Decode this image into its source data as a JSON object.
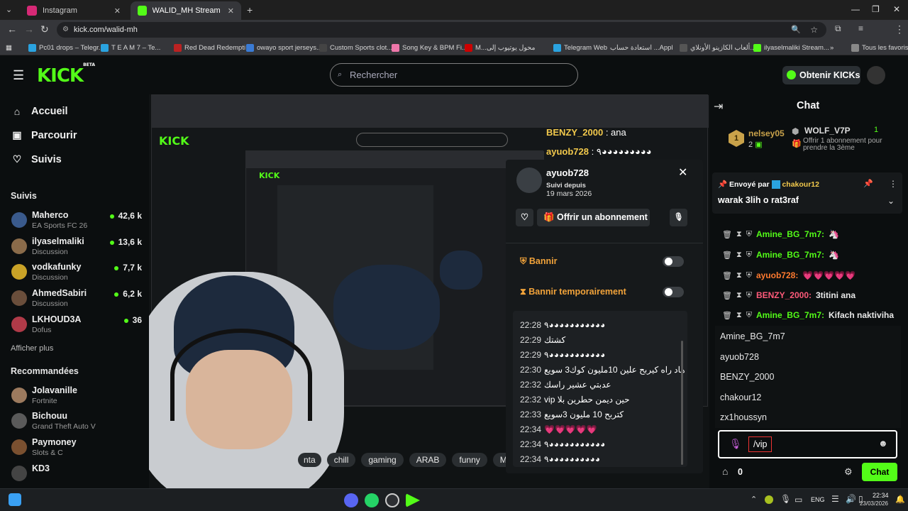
{
  "browser": {
    "tabs": [
      {
        "title": "Instagram",
        "color": "#d62976"
      },
      {
        "title": "WALID_MH Stream - Watch Live",
        "color": "#53fc18"
      }
    ],
    "url": "kick.com/walid-mh",
    "bookmarks": [
      "Pc01 drops – Telegr...",
      "T E A M 7 – Te...",
      "Red Dead Redempti...",
      "owayo sport jerseys...",
      "Custom Sports clot...",
      "Song Key & BPM Fi...",
      "M...محول يوتيوب إلى",
      "Telegram Web",
      "استعادة حساب ...Appl",
      "ألعاب الكازينو الأونلاي...",
      "ilyaselmaliki Stream...",
      "Tous les favoris"
    ]
  },
  "kick": {
    "logo": "KICK",
    "logo_sup": "BETA",
    "search_placeholder": "Rechercher",
    "get_kicks": "Obtenir KICKs"
  },
  "sidebar": {
    "nav": [
      {
        "label": "Accueil",
        "icon": "home-icon"
      },
      {
        "label": "Parcourir",
        "icon": "browse-icon"
      },
      {
        "label": "Suivis",
        "icon": "heart-icon"
      }
    ],
    "followed_title": "Suivis",
    "followed": [
      {
        "name": "Maherco",
        "category": "EA Sports FC 26",
        "viewers": "42,6 k",
        "color": "#3a5a8c"
      },
      {
        "name": "ilyaselmaliki",
        "category": "Discussion",
        "viewers": "13,6 k",
        "color": "#8a6b4a"
      },
      {
        "name": "vodkafunky",
        "category": "Discussion",
        "viewers": "7,7 k",
        "color": "#c9a227"
      },
      {
        "name": "AhmedSabiri",
        "category": "Discussion",
        "viewers": "6,2 k",
        "color": "#6a4e3b"
      },
      {
        "name": "LKHOUD3A",
        "category": "Dofus",
        "viewers": "36",
        "color": "#b03a48"
      }
    ],
    "show_more": "Afficher plus",
    "recommended_title": "Recommandées",
    "recommended": [
      {
        "name": "Jolavanille",
        "category": "Fortnite",
        "color": "#9c7a5e"
      },
      {
        "name": "Bichouu",
        "category": "Grand Theft Auto V",
        "color": "#5a5a5a"
      },
      {
        "name": "Paymoney",
        "category": "Slots & C",
        "color": "#7a5030"
      },
      {
        "name": "KD3",
        "category": "",
        "color": "#444"
      }
    ]
  },
  "stream": {
    "overlay_lines": [
      {
        "user": "BENZY_2000",
        "text": " : ana"
      },
      {
        "user": "ayuob728",
        "text": " : ٩◕◕◕◕◕◕◕◕◕"
      }
    ],
    "tags": [
      "nta",
      "chill",
      "gaming",
      "ARAB",
      "funny",
      "MAR"
    ]
  },
  "user_card": {
    "username": "ayuob728",
    "followed_since_label": "Suivi depuis",
    "followed_since": "19 mars 2026",
    "gift_sub": "Offrir un abonnement",
    "ban": "Bannir",
    "timeout": "Bannir temporairement",
    "history": [
      {
        "time": "22:28",
        "text": "٩◕◕◕◕◕◕◕◕◕◕◕"
      },
      {
        "time": "22:29",
        "text": "كشتك"
      },
      {
        "time": "22:29",
        "text": "٩◕◕◕◕◕◕◕◕◕◕◕"
      },
      {
        "time": "22:30",
        "text": "هاد راه كيربح علين 10مليون كوك3 سويع"
      },
      {
        "time": "22:32",
        "text": "عدبتي عشير راسك"
      },
      {
        "time": "22:32",
        "text": "vip حين ديمن حطرين بلا"
      },
      {
        "time": "22:33",
        "text": "كتربح 10 مليون 3سويع"
      },
      {
        "time": "22:34",
        "text": "💗💗💗💗💗"
      },
      {
        "time": "22:34",
        "text": "٩◕◕◕◕◕◕◕◕◕◕◕"
      },
      {
        "time": "22:34",
        "text": "٩◕◕◕◕◕◕◕◕◕◕"
      }
    ]
  },
  "chat": {
    "title": "Chat",
    "top": [
      {
        "name": "nelsey05",
        "count": "2",
        "rank": "1"
      },
      {
        "name": "WOLF_V7P",
        "count": "1"
      }
    ],
    "top_hint": "Offrir 1 abonnement pour prendre la 3ème",
    "pinned_by_label": "Envoyé par",
    "pinned_by": "chakour12",
    "pinned_message": "warak 3lih o rat3raf",
    "messages": [
      {
        "user": "Amine_BG_7m7:",
        "text": "🦄",
        "color": "#53fc18"
      },
      {
        "user": "Amine_BG_7m7:",
        "text": "🦄",
        "color": "#53fc18"
      },
      {
        "user": "ayuob728:",
        "text": "💗💗💗💗💗",
        "color": "#ff7a2f"
      },
      {
        "user": "BENZY_2000:",
        "text": "3titini ana",
        "color": "#ff5a7a"
      },
      {
        "user": "Amine_BG_7m7:",
        "text": "Kifach naktiviha",
        "color": "#53fc18"
      }
    ],
    "suggestions": [
      "Amine_BG_7m7",
      "ayuob728",
      "BENZY_2000",
      "chakour12",
      "zx1houssyn"
    ],
    "input_value": "/vip",
    "kicks_count": "0",
    "send_label": "Chat"
  },
  "taskbar": {
    "lang": "ENG",
    "time": "22:34",
    "date": "23/03/2026"
  }
}
